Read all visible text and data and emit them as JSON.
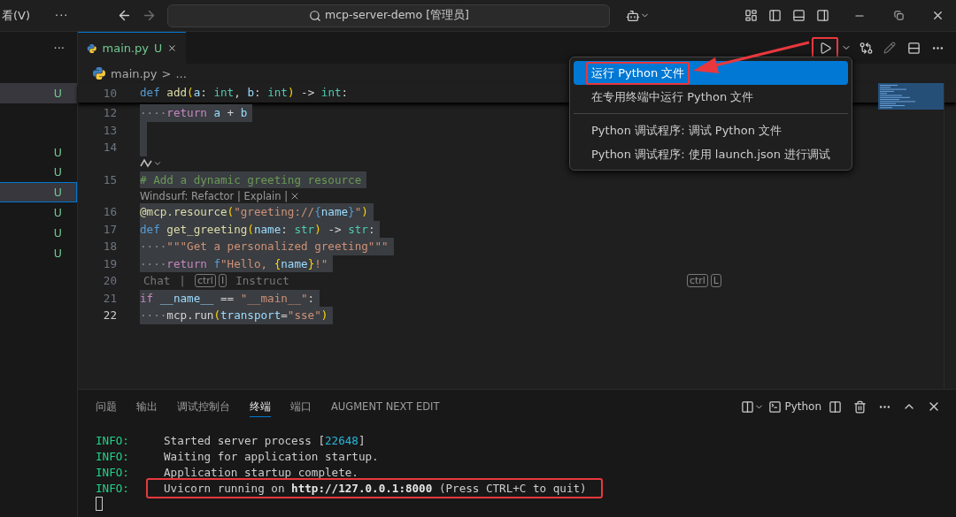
{
  "title_bar": {
    "menu_label": "看(V)",
    "more": "···",
    "search": "mcp-server-demo [管理员]"
  },
  "sidebar": {
    "more": "···",
    "groups": [
      [
        {
          "status": "U",
          "selected": true,
          "focused": false
        }
      ],
      [
        {
          "status": "U",
          "selected": false,
          "focused": false
        },
        {
          "status": "U",
          "selected": false,
          "focused": false
        },
        {
          "status": "U",
          "selected": true,
          "focused": true
        },
        {
          "status": "U",
          "selected": false,
          "focused": false
        },
        {
          "status": "U",
          "selected": false,
          "focused": false
        },
        {
          "status": "U",
          "selected": false,
          "focused": false
        }
      ]
    ]
  },
  "editor": {
    "tabs": [
      {
        "label": "main.py",
        "status": "U",
        "selected": true
      }
    ],
    "run_button": {
      "highlighted": true
    },
    "breadcrumb": {
      "file": "main.py",
      "separator": ">",
      "rest": "..."
    },
    "lines": [
      {
        "kind": "code",
        "number": "10",
        "sticky": true,
        "selected": false,
        "current": false,
        "tokens": [
          {
            "text": "def ",
            "kind": "kw"
          },
          {
            "text": "add",
            "kind": "fn"
          },
          {
            "text": "(",
            "kind": "b1"
          },
          {
            "text": "a",
            "kind": "param"
          },
          {
            "text": ": ",
            "kind": "op"
          },
          {
            "text": "int",
            "kind": "type"
          },
          {
            "text": ", ",
            "kind": "op"
          },
          {
            "text": "b",
            "kind": "param"
          },
          {
            "text": ": ",
            "kind": "op"
          },
          {
            "text": "int",
            "kind": "type"
          },
          {
            "text": ")",
            "kind": "b1"
          },
          {
            "text": " -> ",
            "kind": "op"
          },
          {
            "text": "int",
            "kind": "type"
          },
          {
            "text": ":",
            "kind": "op"
          }
        ]
      },
      {
        "kind": "code",
        "number": "12",
        "sticky": false,
        "selected": true,
        "current": false,
        "tokens": [
          {
            "text": "····",
            "kind": "ws"
          },
          {
            "text": "return ",
            "kind": "ctl"
          },
          {
            "text": "a",
            "kind": "param"
          },
          {
            "text": " + ",
            "kind": "op"
          },
          {
            "text": "b",
            "kind": "param"
          }
        ]
      },
      {
        "kind": "code",
        "number": "13",
        "sticky": false,
        "selected": true,
        "current": false
      },
      {
        "kind": "code",
        "number": "14",
        "sticky": false,
        "selected": true,
        "current": false
      },
      {
        "kind": "lens_icon"
      },
      {
        "kind": "code",
        "number": "15",
        "sticky": false,
        "selected": true,
        "current": false,
        "tokens": [
          {
            "text": "# Add a dynamic greeting resource",
            "kind": "cmt"
          }
        ]
      },
      {
        "kind": "lens",
        "text": "Windsurf: Refactor | Explain |"
      },
      {
        "kind": "code",
        "number": "16",
        "sticky": false,
        "selected": true,
        "current": false,
        "tokens": [
          {
            "text": "@mcp.resource",
            "kind": "fn"
          },
          {
            "text": "(",
            "kind": "b1"
          },
          {
            "text": "\"greeting://",
            "kind": "str"
          },
          {
            "text": "{",
            "kind": "esc"
          },
          {
            "text": "name",
            "kind": "param"
          },
          {
            "text": "}",
            "kind": "esc"
          },
          {
            "text": "\"",
            "kind": "str"
          },
          {
            "text": ")",
            "kind": "b1"
          }
        ]
      },
      {
        "kind": "code",
        "number": "17",
        "sticky": false,
        "selected": true,
        "current": false,
        "tokens": [
          {
            "text": "def ",
            "kind": "kw"
          },
          {
            "text": "get_greeting",
            "kind": "fn"
          },
          {
            "text": "(",
            "kind": "b1"
          },
          {
            "text": "name",
            "kind": "param"
          },
          {
            "text": ": ",
            "kind": "op"
          },
          {
            "text": "str",
            "kind": "type"
          },
          {
            "text": ")",
            "kind": "b1"
          },
          {
            "text": " -> ",
            "kind": "op"
          },
          {
            "text": "str",
            "kind": "type"
          },
          {
            "text": ":",
            "kind": "op"
          }
        ]
      },
      {
        "kind": "code",
        "number": "18",
        "sticky": false,
        "selected": true,
        "current": false,
        "tokens": [
          {
            "text": "····",
            "kind": "ws"
          },
          {
            "text": "\"\"\"Get a personalized greeting\"\"\"",
            "kind": "str"
          }
        ]
      },
      {
        "kind": "code",
        "number": "19",
        "sticky": false,
        "selected": true,
        "current": false,
        "tokens": [
          {
            "text": "····",
            "kind": "ws"
          },
          {
            "text": "return ",
            "kind": "ctl"
          },
          {
            "text": "f",
            "kind": "kw"
          },
          {
            "text": "\"Hello, ",
            "kind": "str"
          },
          {
            "text": "{",
            "kind": "b1"
          },
          {
            "text": "name",
            "kind": "param"
          },
          {
            "text": "}",
            "kind": "b1"
          },
          {
            "text": "!\"",
            "kind": "str"
          }
        ]
      },
      {
        "kind": "hint",
        "number": "20",
        "chat": "Chat",
        "sep": "|",
        "keys": [
          "ctrl",
          "I"
        ],
        "action": "Instruct",
        "right_keys": [
          "ctrl",
          "L"
        ]
      },
      {
        "kind": "code",
        "number": "21",
        "sticky": false,
        "selected": true,
        "current": false,
        "tokens": [
          {
            "text": "if ",
            "kind": "ctl"
          },
          {
            "text": "__name__",
            "kind": "param"
          },
          {
            "text": " == ",
            "kind": "op"
          },
          {
            "text": "\"__main__\"",
            "kind": "str"
          },
          {
            "text": ":",
            "kind": "op"
          }
        ]
      },
      {
        "kind": "code",
        "number": "22",
        "sticky": false,
        "selected": true,
        "current": true,
        "tokens": [
          {
            "text": "····",
            "kind": "ws"
          },
          {
            "text": "mcp.run",
            "kind": "op"
          },
          {
            "text": "(",
            "kind": "b1"
          },
          {
            "text": "transport",
            "kind": "param"
          },
          {
            "text": "=",
            "kind": "op"
          },
          {
            "text": "\"sse\"",
            "kind": "str"
          },
          {
            "text": ")",
            "kind": "b1"
          }
        ]
      }
    ]
  },
  "run_menu": {
    "groups": [
      [
        {
          "label": "运行 Python 文件",
          "selected": true,
          "highlighted": true
        },
        {
          "label": "在专用终端中运行 Python 文件",
          "selected": false,
          "highlighted": false
        }
      ],
      [
        {
          "label": "Python 调试程序: 调试 Python 文件",
          "selected": false,
          "highlighted": false
        },
        {
          "label": "Python 调试程序: 使用 launch.json 进行调试",
          "selected": false,
          "highlighted": false
        }
      ]
    ]
  },
  "panel": {
    "tabs": [
      {
        "label": "问题",
        "selected": false
      },
      {
        "label": "输出",
        "selected": false
      },
      {
        "label": "调试控制台",
        "selected": false
      },
      {
        "label": "终端",
        "selected": true
      },
      {
        "label": "端口",
        "selected": false
      },
      {
        "label": "AUGMENT NEXT EDIT",
        "selected": false
      }
    ],
    "terminal_name": "Python",
    "terminal": [
      {
        "level": "INFO:",
        "highlighted": false,
        "parts": [
          {
            "text": "Started server process [",
            "kind": "plain"
          },
          {
            "text": "22648",
            "kind": "num"
          },
          {
            "text": "]",
            "kind": "plain"
          }
        ]
      },
      {
        "level": "INFO:",
        "highlighted": false,
        "parts": [
          {
            "text": "Waiting for application startup.",
            "kind": "plain"
          }
        ]
      },
      {
        "level": "INFO:",
        "highlighted": false,
        "parts": [
          {
            "text": "Application startup complete.",
            "kind": "plain"
          }
        ]
      },
      {
        "level": "INFO:",
        "highlighted": true,
        "parts": [
          {
            "text": "Uvicorn running on ",
            "kind": "plain"
          },
          {
            "text": "http://127.0.0.1:8000",
            "kind": "bold"
          },
          {
            "text": " (Press CTRL+C to quit)",
            "kind": "plain"
          }
        ]
      }
    ]
  }
}
